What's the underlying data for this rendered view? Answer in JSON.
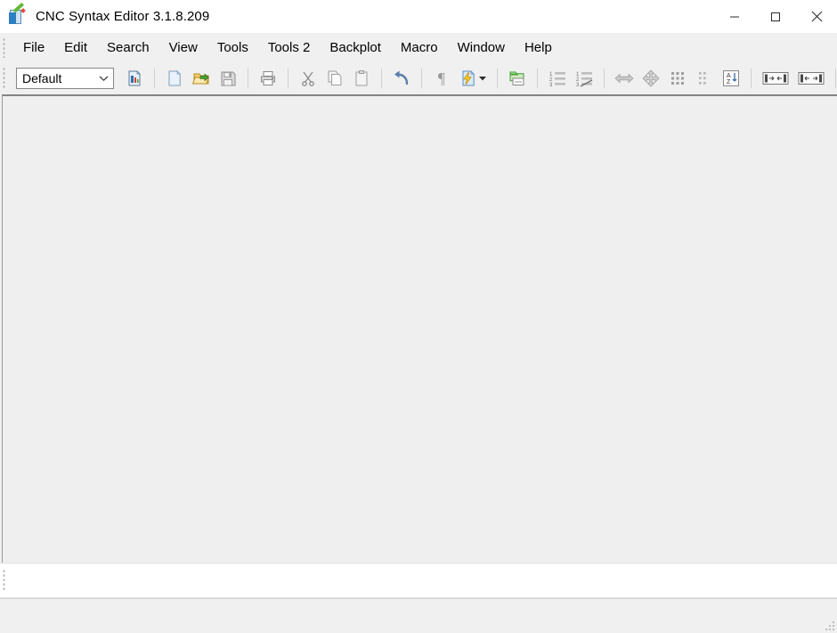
{
  "window": {
    "title": "CNC Syntax Editor 3.1.8.209",
    "app_icon": "cnc-syntax-editor-icon",
    "controls": {
      "minimize": "minimize-icon",
      "maximize": "maximize-icon",
      "close": "close-icon"
    }
  },
  "menu": {
    "items": [
      {
        "label": "File"
      },
      {
        "label": "Edit"
      },
      {
        "label": "Search"
      },
      {
        "label": "View"
      },
      {
        "label": "Tools"
      },
      {
        "label": "Tools 2"
      },
      {
        "label": "Backplot"
      },
      {
        "label": "Macro"
      },
      {
        "label": "Window"
      },
      {
        "label": "Help"
      }
    ]
  },
  "toolbar": {
    "profile_combo": {
      "value": "Default",
      "options": [
        "Default"
      ]
    },
    "buttons": [
      {
        "name": "document-properties",
        "icon": "document-properties-icon",
        "enabled": true
      },
      {
        "name": "new-file",
        "icon": "new-file-icon",
        "enabled": true
      },
      {
        "name": "open-file",
        "icon": "open-folder-icon",
        "enabled": true
      },
      {
        "name": "save-file",
        "icon": "save-floppy-icon",
        "enabled": false
      },
      {
        "name": "print",
        "icon": "printer-icon",
        "enabled": true
      },
      {
        "name": "cut",
        "icon": "scissors-icon",
        "enabled": false
      },
      {
        "name": "copy",
        "icon": "copy-icon",
        "enabled": false
      },
      {
        "name": "paste",
        "icon": "clipboard-paste-icon",
        "enabled": false
      },
      {
        "name": "undo",
        "icon": "undo-arrow-icon",
        "enabled": true
      },
      {
        "name": "show-formatting-marks",
        "icon": "pilcrow-icon",
        "enabled": false
      },
      {
        "name": "run-macro",
        "icon": "document-lightning-icon",
        "enabled": true
      },
      {
        "name": "file-compare",
        "icon": "green-folder-window-icon",
        "enabled": true
      },
      {
        "name": "renumber-lines",
        "icon": "numbered-list-icon",
        "enabled": true
      },
      {
        "name": "remove-line-numbers",
        "icon": "numbered-list-strike-icon",
        "enabled": true
      },
      {
        "name": "horizontal-shift",
        "icon": "left-right-arrow-icon",
        "enabled": false
      },
      {
        "name": "move-all-directions",
        "icon": "four-way-arrow-icon",
        "enabled": false
      },
      {
        "name": "grid-dots",
        "icon": "dotted-grid-icon",
        "enabled": false
      },
      {
        "name": "grid-dots-secondary",
        "icon": "dotted-grid-small-icon",
        "enabled": false
      },
      {
        "name": "sort-az",
        "icon": "sort-az-icon",
        "enabled": true
      },
      {
        "name": "expand-spacing",
        "icon": "expand-brackets-icon",
        "enabled": true
      },
      {
        "name": "contract-spacing",
        "icon": "contract-brackets-icon",
        "enabled": true
      },
      {
        "name": "split-view",
        "icon": "split-view-icon",
        "enabled": true
      }
    ]
  },
  "editor": {
    "content": "",
    "placeholder": ""
  },
  "dock_panel": {
    "content": ""
  },
  "status_bar": {
    "text": "",
    "resize_grip": "resize-grip-icon"
  },
  "colors": {
    "window_background": "#f0f0f0",
    "editor_background": "#efefef",
    "title_background": "#ffffff",
    "accent_blue": "#2d7fc1",
    "folder_yellow": "#f0c040",
    "lightning_yellow": "#ffd21e",
    "green": "#3f9b35",
    "disabled_grey": "#9a9a9a"
  }
}
